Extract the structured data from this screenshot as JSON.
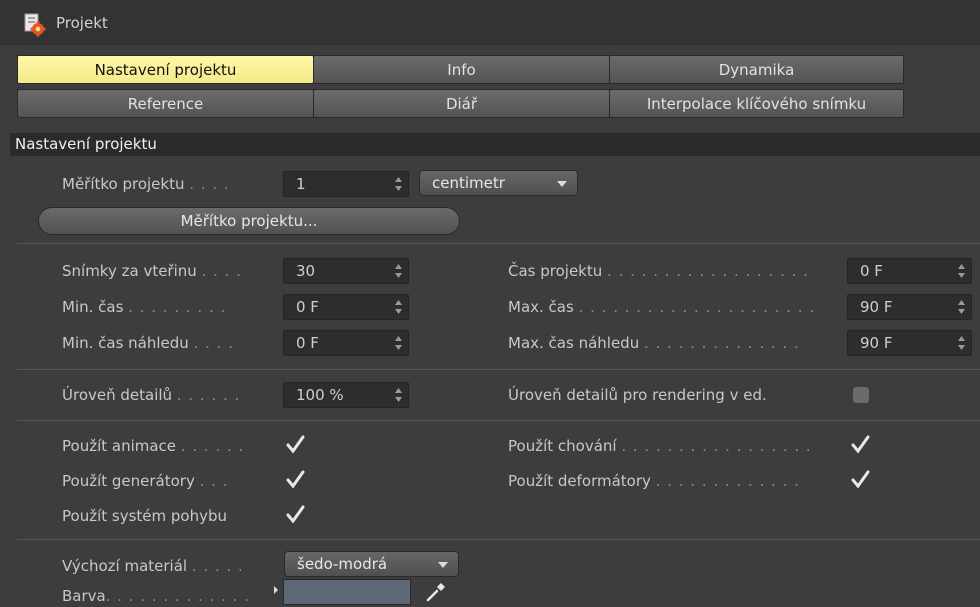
{
  "window": {
    "title": "Projekt",
    "icon": "project-settings-icon"
  },
  "tabs": [
    {
      "label": "Nastavení projektu",
      "active": true
    },
    {
      "label": "Info"
    },
    {
      "label": "Dynamika"
    },
    {
      "label": "Reference"
    },
    {
      "label": "Diář"
    },
    {
      "label": "Interpolace klíčového snímku"
    }
  ],
  "section": {
    "title": "Nastavení projektu"
  },
  "scale": {
    "label": "Měřítko projektu",
    "dots": ". . . .",
    "value": "1",
    "unit": "centimetr",
    "button": "Měřítko projektu..."
  },
  "time": {
    "fps": {
      "label": "Snímky za vteřinu",
      "dots": ". . . .",
      "value": "30"
    },
    "min": {
      "label": "Min. čas",
      "dots": ". . . . . . . . .",
      "value": "0 F"
    },
    "min_preview": {
      "label": "Min. čas náhledu",
      "dots": ". . . .",
      "value": "0 F"
    },
    "project_time": {
      "label": "Čas projektu",
      "dots": ". . . . . . . . . . . . . . . . . .",
      "value": "0 F"
    },
    "max": {
      "label": "Max. čas",
      "dots": ". . . . . . . . . . . . . . . . . . . . .",
      "value": "90 F"
    },
    "max_preview": {
      "label": "Max. čas náhledu",
      "dots": ". . . . . . . . . . . . . .",
      "value": "90 F"
    }
  },
  "detail": {
    "label": "Úroveň detailů",
    "dots": ". . . . . .",
    "value": "100 %",
    "render_label": "Úroveň detailů pro rendering v ed.",
    "render_checked": false
  },
  "use": {
    "animation": {
      "label": "Použít animace",
      "dots": ". . . . . .",
      "checked": true
    },
    "generators": {
      "label": "Použít generátory",
      "dots": ". . .",
      "checked": true
    },
    "motion": {
      "label": "Použít systém pohybu",
      "checked": true
    },
    "behavior": {
      "label": "Použít chování",
      "dots": ". . . . . . . . . . . . . . . . .",
      "checked": true
    },
    "deformers": {
      "label": "Použít deformátory",
      "dots": ". . . . . . . . . . . . .",
      "checked": true
    }
  },
  "material": {
    "label": "Výchozí materiál",
    "dots": ". . . . .",
    "value": "šedo-modrá",
    "color_label": "Barva",
    "color_dots": ". . . . . . . . . . . . .",
    "color": "#5d6a76"
  },
  "colors": {
    "accent": "#f4ea8a",
    "background": "#3d3d3d",
    "field": "#2d2d2d"
  }
}
